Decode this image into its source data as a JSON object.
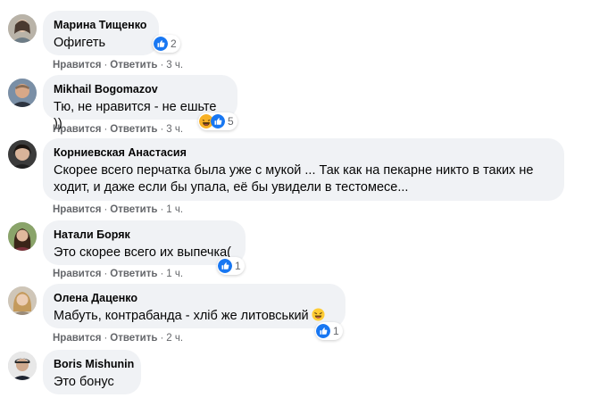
{
  "actions": {
    "like": "Нравится",
    "reply": "Ответить",
    "separator": "·"
  },
  "colors": {
    "bubble": "#f0f2f5",
    "like_blue": "#1877f2",
    "meta_gray": "#65676b"
  },
  "comments": [
    {
      "author": "Марина Тищенко",
      "text": "Офигеть",
      "time": "3 ч.",
      "reactions": {
        "icons": [
          "like-icon"
        ],
        "count": "2"
      }
    },
    {
      "author": "Mikhail Bogomazov",
      "text": "Тю, не нравится - не ешьте ))",
      "time": "3 ч.",
      "reactions": {
        "icons": [
          "haha-icon",
          "like-icon"
        ],
        "count": "5"
      }
    },
    {
      "author": "Корниевская Анастасия",
      "text": "Скорее всего перчатка была уже с мукой ... Так как на пекарне никто в таких не\nходит, и даже если бы упала, её бы увидели в тестомесе...",
      "time": "1 ч."
    },
    {
      "author": "Натали Боряк",
      "text": "Это скорее всего их выпечка(",
      "time": "1 ч.",
      "reactions": {
        "icons": [
          "like-icon"
        ],
        "count": "1"
      }
    },
    {
      "author": "Олена Даценко",
      "text": "Мабуть, контрабанда - хліб же литовський",
      "text_emoji": "laughing-emoji-icon",
      "time": "2 ч.",
      "reactions": {
        "icons": [
          "like-icon"
        ],
        "count": "1"
      }
    },
    {
      "author": "Boris Mishunin",
      "text": "Это бонус"
    }
  ]
}
